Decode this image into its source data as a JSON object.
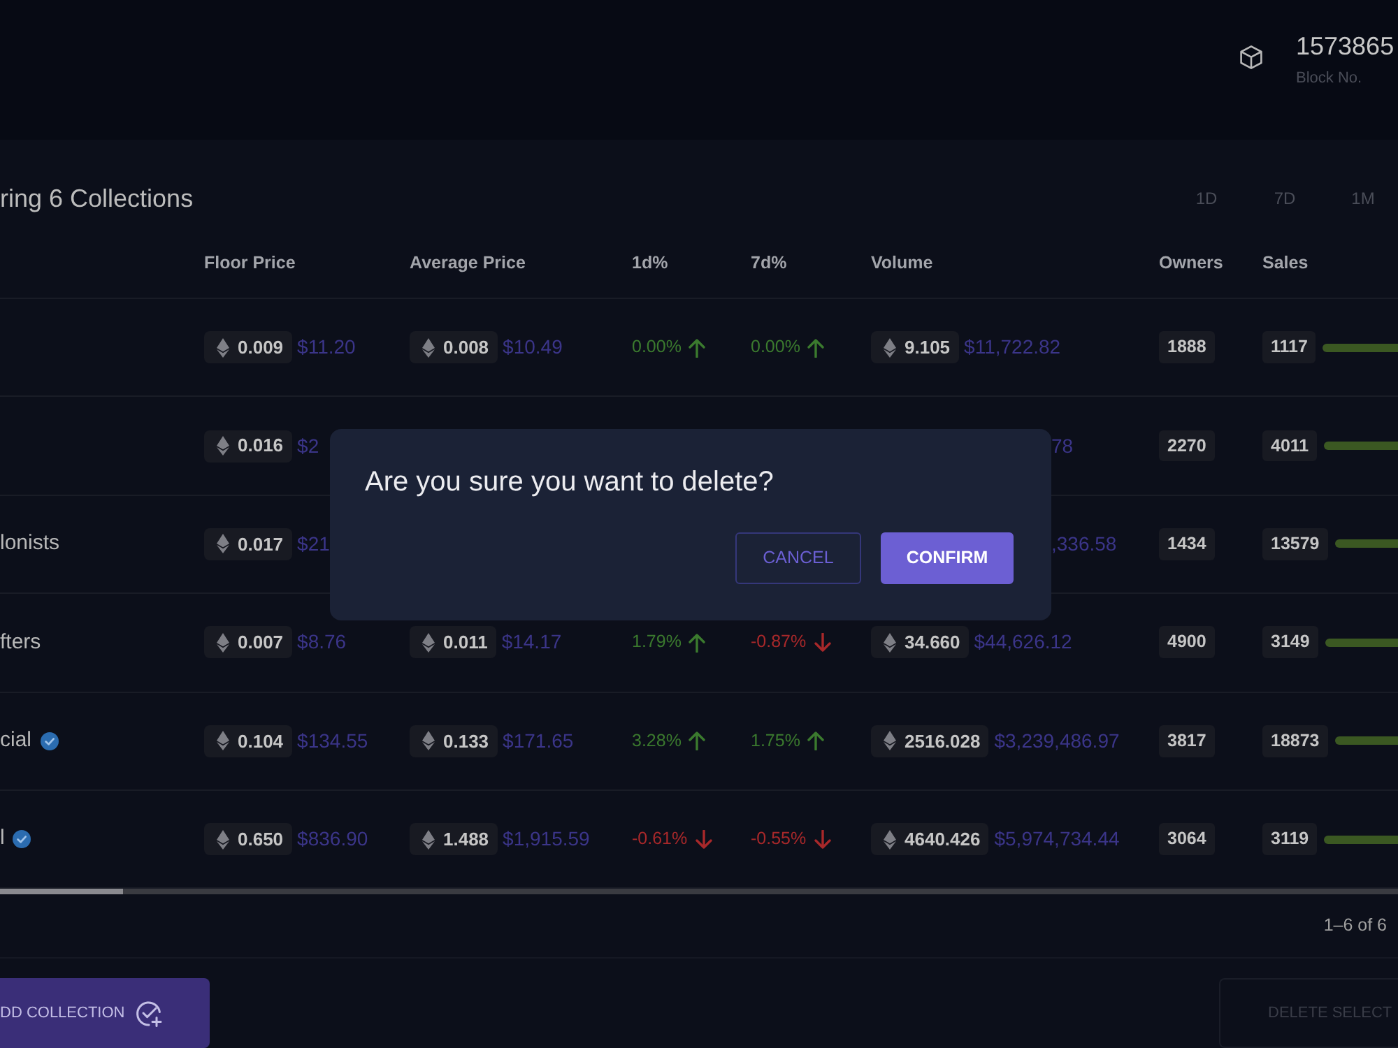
{
  "header": {
    "block_number": "1573865",
    "block_label": "Block No."
  },
  "collections": {
    "title": "ring 6 Collections",
    "periods": [
      "1D",
      "7D",
      "1M"
    ]
  },
  "table": {
    "columns": [
      "Floor Price",
      "Average Price",
      "1d%",
      "7d%",
      "Volume",
      "Owners",
      "Sales"
    ],
    "rows": [
      {
        "verified": false,
        "floor": {
          "eth": "0.009",
          "usd": "$11.20"
        },
        "average": {
          "eth": "0.008",
          "usd": "$10.49"
        },
        "change_1d": {
          "value": "0.00%",
          "kind": "up"
        },
        "change_7d": {
          "value": "0.00%",
          "kind": "up"
        },
        "volume": {
          "eth": "9.105",
          "usd": "$11,722.82"
        },
        "owners": "1888",
        "sales": "1117"
      },
      {
        "verified": false,
        "floor": {
          "eth": "0.016",
          "usd": "$2"
        },
        "volume": {
          "usd": "78"
        },
        "owners": "2270",
        "sales": "4011"
      },
      {
        "name": "lonists",
        "verified": false,
        "floor": {
          "eth": "0.017",
          "usd": "$21"
        },
        "volume": {
          "usd": ",336.58"
        },
        "owners": "1434",
        "sales": "13579"
      },
      {
        "name": "fters",
        "verified": false,
        "floor": {
          "eth": "0.007",
          "usd": "$8.76"
        },
        "average": {
          "eth": "0.011",
          "usd": "$14.17"
        },
        "change_1d": {
          "value": "1.79%",
          "kind": "up"
        },
        "change_7d": {
          "value": "-0.87%",
          "kind": "down"
        },
        "volume": {
          "eth": "34.660",
          "usd": "$44,626.12"
        },
        "owners": "4900",
        "sales": "3149"
      },
      {
        "name": "cial",
        "verified": true,
        "floor": {
          "eth": "0.104",
          "usd": "$134.55"
        },
        "average": {
          "eth": "0.133",
          "usd": "$171.65"
        },
        "change_1d": {
          "value": "3.28%",
          "kind": "up"
        },
        "change_7d": {
          "value": "1.75%",
          "kind": "up"
        },
        "volume": {
          "eth": "2516.028",
          "usd": "$3,239,486.97"
        },
        "owners": "3817",
        "sales": "18873"
      },
      {
        "name": "l",
        "verified": true,
        "floor": {
          "eth": "0.650",
          "usd": "$836.90"
        },
        "average": {
          "eth": "1.488",
          "usd": "$1,915.59"
        },
        "change_1d": {
          "value": "-0.61%",
          "kind": "down"
        },
        "change_7d": {
          "value": "-0.55%",
          "kind": "down"
        },
        "volume": {
          "eth": "4640.426",
          "usd": "$5,974,734.44"
        },
        "owners": "3064",
        "sales": "3119"
      }
    ]
  },
  "pagination": "1–6 of 6",
  "actions": [
    {
      "label": "DD COLLECTION",
      "kind": "primary",
      "disabled": false
    },
    {
      "label": "DELETE SELECT",
      "kind": "outline",
      "disabled": true
    }
  ],
  "dialog": {
    "message": "Are you sure you want to delete?",
    "buttons": [
      {
        "label": "CANCEL",
        "kind": "outline"
      },
      {
        "label": "CONFIRM",
        "kind": "primary"
      }
    ]
  }
}
